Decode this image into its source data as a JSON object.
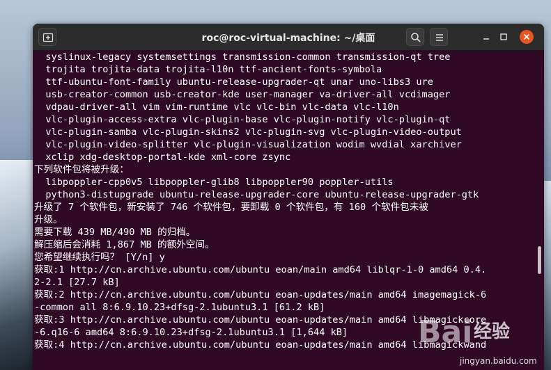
{
  "window": {
    "title": "roc@roc-virtual-machine: ~/桌面"
  },
  "terminal": {
    "lines": [
      "  syslinux-legacy systemsettings transmission-common transmission-qt tree",
      "  trojita trojita-data trojita-l10n ttf-ancient-fonts-symbola",
      "  ttf-ubuntu-font-family ubuntu-release-upgrader-qt unar uno-libs3 ure",
      "  usb-creator-common usb-creator-kde user-manager va-driver-all vcdimager",
      "  vdpau-driver-all vim vim-runtime vlc vlc-bin vlc-data vlc-l10n",
      "  vlc-plugin-access-extra vlc-plugin-base vlc-plugin-notify vlc-plugin-qt",
      "  vlc-plugin-samba vlc-plugin-skins2 vlc-plugin-svg vlc-plugin-video-output",
      "  vlc-plugin-video-splitter vlc-plugin-visualization wodim wvdial xarchiver",
      "  xclip xdg-desktop-portal-kde xml-core zsync",
      "下列软件包将被升级：",
      "  libpoppler-cpp0v5 libpoppler-glib8 libpoppler90 poppler-utils",
      "  python3-distupgrade ubuntu-release-upgrader-core ubuntu-release-upgrader-gtk",
      "升级了 7 个软件包，新安装了 746 个软件包，要卸载 0 个软件包，有 160 个软件包未被",
      "升级。",
      "需要下载 439 MB/490 MB 的归档。",
      "解压缩后会消耗 1,867 MB 的额外空间。",
      "您希望继续执行吗？ [Y/n] y",
      "获取:1 http://cn.archive.ubuntu.com/ubuntu eoan/main amd64 liblqr-1-0 amd64 0.4.",
      "2-2.1 [27.7 kB]",
      "获取:2 http://cn.archive.ubuntu.com/ubuntu eoan-updates/main amd64 imagemagick-6",
      "-common all 8:6.9.10.23+dfsg-2.1ubuntu3.1 [61.2 kB]",
      "获取:3 http://cn.archive.ubuntu.com/ubuntu eoan-updates/main amd64 libmagickcore",
      "-6.q16-6 amd64 8:6.9.10.23+dfsg-2.1ubuntu3.1 [1,644 kB]",
      "获取:4 http://cn.archive.ubuntu.com/ubuntu eoan-updates/main amd64 libmagickwand"
    ]
  },
  "watermark": {
    "brand": "Bai",
    "text": "经验",
    "url": "jingyan.baidu.com"
  },
  "colors": {
    "terminal_bg": "#300a24",
    "titlebar_bg": "#2c2c2c",
    "close_accent": "#e95420"
  },
  "icons": {
    "new_tab": "new-tab-icon",
    "search": "search-icon",
    "menu": "hamburger-menu-icon",
    "minimize": "minimize-icon",
    "maximize": "maximize-icon",
    "close": "close-icon"
  }
}
